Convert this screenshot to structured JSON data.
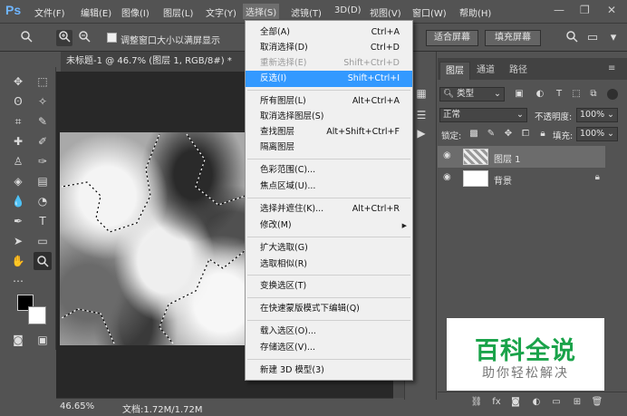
{
  "app": {
    "logo": "Ps"
  },
  "menubar": {
    "items": [
      "文件(F)",
      "编辑(E)",
      "图像(I)",
      "图层(L)",
      "文字(Y)",
      "选择(S)",
      "滤镜(T)",
      "3D(D)",
      "视图(V)",
      "窗口(W)",
      "帮助(H)"
    ],
    "window_controls": {
      "minimize": "—",
      "restore": "❐",
      "close": "✕"
    }
  },
  "options_bar": {
    "zoom_tool_icon": "zoom-icon",
    "resize_windows_label": "调整窗口大小以满屏显示",
    "fit_screen_label": "适合屏幕",
    "fill_screen_label": "填充屏幕"
  },
  "document": {
    "tab_title": "未标题-1 @ 46.7% (图层 1, RGB/8#) *",
    "tab_close": "✕",
    "zoom": "46.65%",
    "doc_info": "文档:1.72M/1.72M"
  },
  "select_menu": {
    "items": [
      {
        "label": "全部(A)",
        "shortcut": "Ctrl+A",
        "state": "normal"
      },
      {
        "label": "取消选择(D)",
        "shortcut": "Ctrl+D",
        "state": "normal"
      },
      {
        "label": "重新选择(E)",
        "shortcut": "Shift+Ctrl+D",
        "state": "disabled"
      },
      {
        "label": "反选(I)",
        "shortcut": "Shift+Ctrl+I",
        "state": "highlighted"
      },
      {
        "label": "所有图层(L)",
        "shortcut": "Alt+Ctrl+A",
        "state": "normal"
      },
      {
        "label": "取消选择图层(S)",
        "shortcut": "",
        "state": "normal"
      },
      {
        "label": "查找图层",
        "shortcut": "Alt+Shift+Ctrl+F",
        "state": "normal"
      },
      {
        "label": "隔离图层",
        "shortcut": "",
        "state": "normal"
      },
      {
        "label": "色彩范围(C)...",
        "shortcut": "",
        "state": "normal"
      },
      {
        "label": "焦点区域(U)...",
        "shortcut": "",
        "state": "normal"
      },
      {
        "label": "选择并遮住(K)...",
        "shortcut": "Alt+Ctrl+R",
        "state": "normal"
      },
      {
        "label": "修改(M)",
        "shortcut": "",
        "state": "submenu"
      },
      {
        "label": "扩大选取(G)",
        "shortcut": "",
        "state": "normal"
      },
      {
        "label": "选取相似(R)",
        "shortcut": "",
        "state": "normal"
      },
      {
        "label": "变换选区(T)",
        "shortcut": "",
        "state": "normal"
      },
      {
        "label": "在快速蒙版模式下编辑(Q)",
        "shortcut": "",
        "state": "normal"
      },
      {
        "label": "载入选区(O)...",
        "shortcut": "",
        "state": "normal"
      },
      {
        "label": "存储选区(V)...",
        "shortcut": "",
        "state": "normal"
      },
      {
        "label": "新建 3D 模型(3)",
        "shortcut": "",
        "state": "normal"
      }
    ],
    "submenu_arrow": "▶"
  },
  "layers_panel": {
    "tabs": [
      "图层",
      "通道",
      "路径"
    ],
    "filter_kind": "类型",
    "blend_mode": "正常",
    "opacity_label": "不透明度:",
    "opacity_value": "100%",
    "lock_label": "锁定:",
    "fill_label": "填充:",
    "fill_value": "100%",
    "layers": [
      {
        "name": "图层 1",
        "selected": true,
        "locked": false
      },
      {
        "name": "背景",
        "selected": false,
        "locked": true
      }
    ],
    "footer_icons": [
      "link-icon",
      "fx-icon",
      "mask-icon",
      "adjustment-icon",
      "group-icon",
      "new-layer-icon",
      "trash-icon"
    ],
    "fx_label": "fx"
  },
  "watermark": {
    "title": "百科全说",
    "subtitle": "助你轻松解决"
  },
  "colors": {
    "highlight": "#3399ff",
    "watermark_green": "#1aa34a",
    "ps_blue": "#6fb5ff"
  }
}
